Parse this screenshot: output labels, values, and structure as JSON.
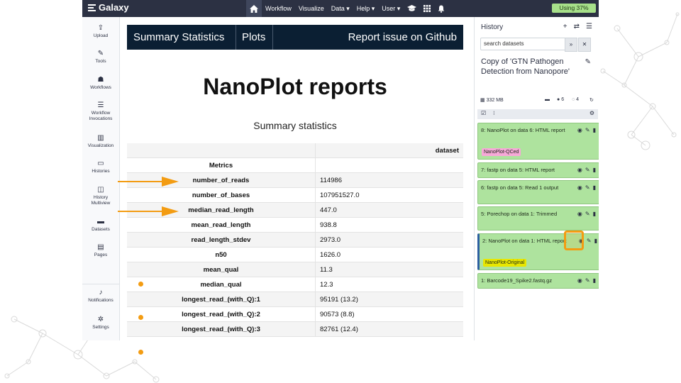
{
  "brand": {
    "name": "Galaxy"
  },
  "nav": {
    "items": [
      "Workflow",
      "Visualize",
      "Data ▾",
      "Help ▾",
      "User ▾"
    ],
    "usage": "Using 37%"
  },
  "leftbar": [
    {
      "label": "Upload",
      "icon": "upload-icon"
    },
    {
      "label": "Tools",
      "icon": "wrench-icon"
    },
    {
      "label": "Workflows",
      "icon": "sitemap-icon"
    },
    {
      "label": "Workflow Invocations",
      "icon": "list-icon"
    },
    {
      "label": "Visualization",
      "icon": "chart-icon"
    },
    {
      "label": "Histories",
      "icon": "hdd-icon"
    },
    {
      "label": "History Multiview",
      "icon": "columns-icon"
    },
    {
      "label": "Datasets",
      "icon": "folder-icon"
    },
    {
      "label": "Pages",
      "icon": "file-icon"
    },
    {
      "label": "Notifications",
      "icon": "bell-icon"
    },
    {
      "label": "Settings",
      "icon": "cog-icon"
    }
  ],
  "report": {
    "tabs": [
      "Summary Statistics",
      "Plots"
    ],
    "issue_link": "Report issue on Github",
    "title": "NanoPlot reports",
    "subtitle": "Summary statistics",
    "table": {
      "column_header": "dataset",
      "metrics_header": "Metrics",
      "rows": [
        [
          "number_of_reads",
          "114986"
        ],
        [
          "number_of_bases",
          "107951527.0"
        ],
        [
          "median_read_length",
          "447.0"
        ],
        [
          "mean_read_length",
          "938.8"
        ],
        [
          "read_length_stdev",
          "2973.0"
        ],
        [
          "n50",
          "1626.0"
        ],
        [
          "mean_qual",
          "11.3"
        ],
        [
          "median_qual",
          "12.3"
        ],
        [
          "longest_read_(with_Q):1",
          "95191 (13.2)"
        ],
        [
          "longest_read_(with_Q):2",
          "90573 (8.8)"
        ],
        [
          "longest_read_(with_Q):3",
          "82761 (12.4)"
        ]
      ]
    }
  },
  "history": {
    "title": "History",
    "search_placeholder": "search datasets",
    "name": "Copy of 'GTN Pathogen Detection from Nanopore'",
    "size": "332 MB",
    "counts": {
      "shown": "6",
      "hidden": "4"
    },
    "datasets": [
      {
        "title": "8: NanoPlot on data 6: HTML report",
        "tag": "NanoPlot-QCed",
        "tag_color": "#f7a8d8"
      },
      {
        "title": "7: fastp on data 5: HTML report",
        "tag": ""
      },
      {
        "title": "6: fastp on data 5: Read 1 output",
        "tag": ""
      },
      {
        "title": "5: Porechop on data 1: Trimmed",
        "tag": ""
      },
      {
        "title": "2: NanoPlot on data 1: HTML report",
        "tag": "NanoPlot-Original",
        "tag_color": "#e8e600"
      },
      {
        "title": "1: Barcode19_Spike2.fastq.gz",
        "tag": ""
      }
    ]
  },
  "colors": {
    "accent": "#f39c12",
    "masthead": "#2c3143",
    "dataset_ok": "#aee39e",
    "report_bar": "#0b1f33"
  }
}
